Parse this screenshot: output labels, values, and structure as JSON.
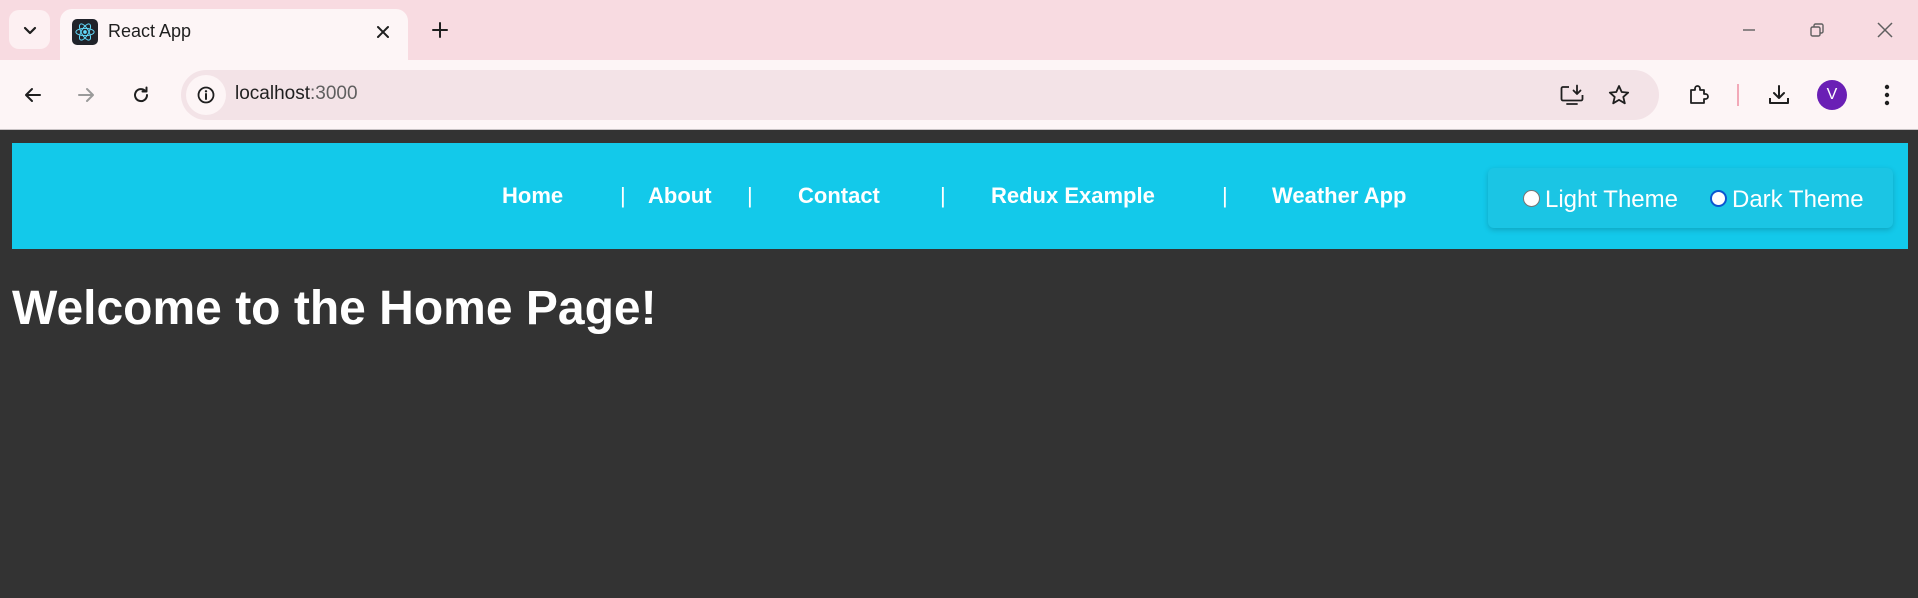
{
  "browser": {
    "tab_title": "React App",
    "url_host": "localhost",
    "url_port": ":3000",
    "profile_initial": "V",
    "icons": {
      "tab_search": "chevron-down-icon",
      "favicon": "react-logo-icon",
      "tab_close": "close-icon",
      "new_tab": "plus-icon",
      "minimize": "minimize-icon",
      "restore": "restore-icon",
      "close_window": "close-icon",
      "back": "back-arrow-icon",
      "forward": "forward-arrow-icon",
      "reload": "reload-icon",
      "site_info": "info-icon",
      "install": "install-app-icon",
      "bookmark": "star-icon",
      "extensions": "puzzle-icon",
      "downloads": "download-icon",
      "menu": "kebab-menu-icon"
    }
  },
  "navbar": {
    "links": [
      "Home",
      "About",
      "Contact",
      "Redux Example",
      "Weather App"
    ],
    "separator": "|"
  },
  "theme_switcher": {
    "options": [
      "Light Theme",
      "Dark Theme"
    ],
    "selected": "Dark Theme"
  },
  "main": {
    "heading": "Welcome to the Home Page!"
  },
  "colors": {
    "navbar_bg": "#13c9ea",
    "page_bg": "#333333",
    "tabstrip_bg": "#f8dbe1",
    "avatar_bg": "#6a1fb5"
  }
}
